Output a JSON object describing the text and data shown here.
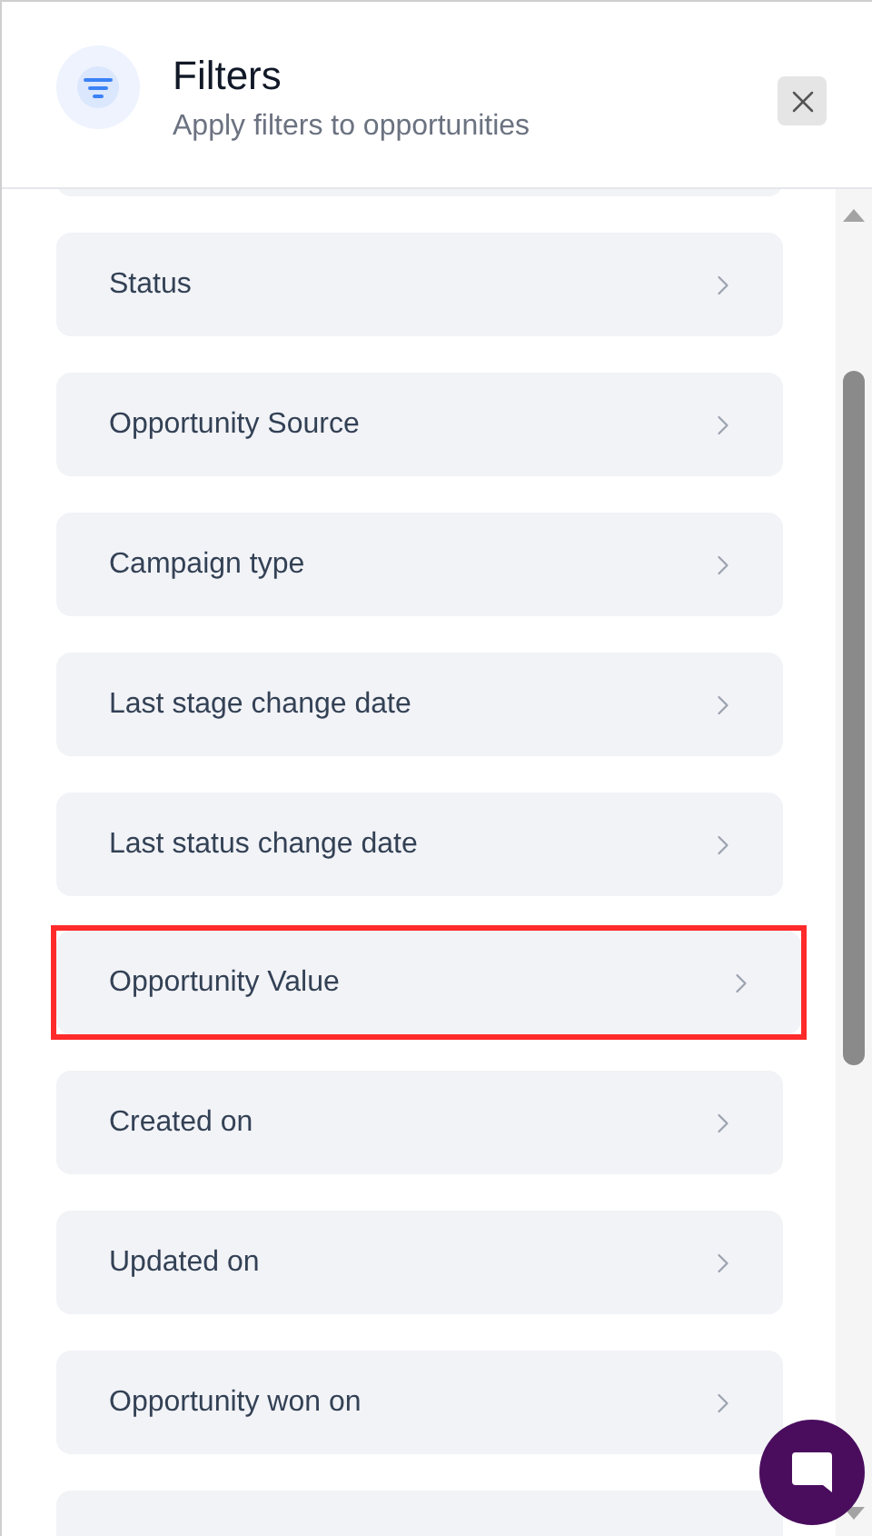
{
  "header": {
    "title": "Filters",
    "subtitle": "Apply filters to opportunities"
  },
  "filters": [
    {
      "label": "Status",
      "highlighted": false
    },
    {
      "label": "Opportunity Source",
      "highlighted": false
    },
    {
      "label": "Campaign type",
      "highlighted": false
    },
    {
      "label": "Last stage change date",
      "highlighted": false
    },
    {
      "label": "Last status change date",
      "highlighted": false
    },
    {
      "label": "Opportunity Value",
      "highlighted": true
    },
    {
      "label": "Created on",
      "highlighted": false
    },
    {
      "label": "Updated on",
      "highlighted": false
    },
    {
      "label": "Opportunity won on",
      "highlighted": false
    }
  ]
}
